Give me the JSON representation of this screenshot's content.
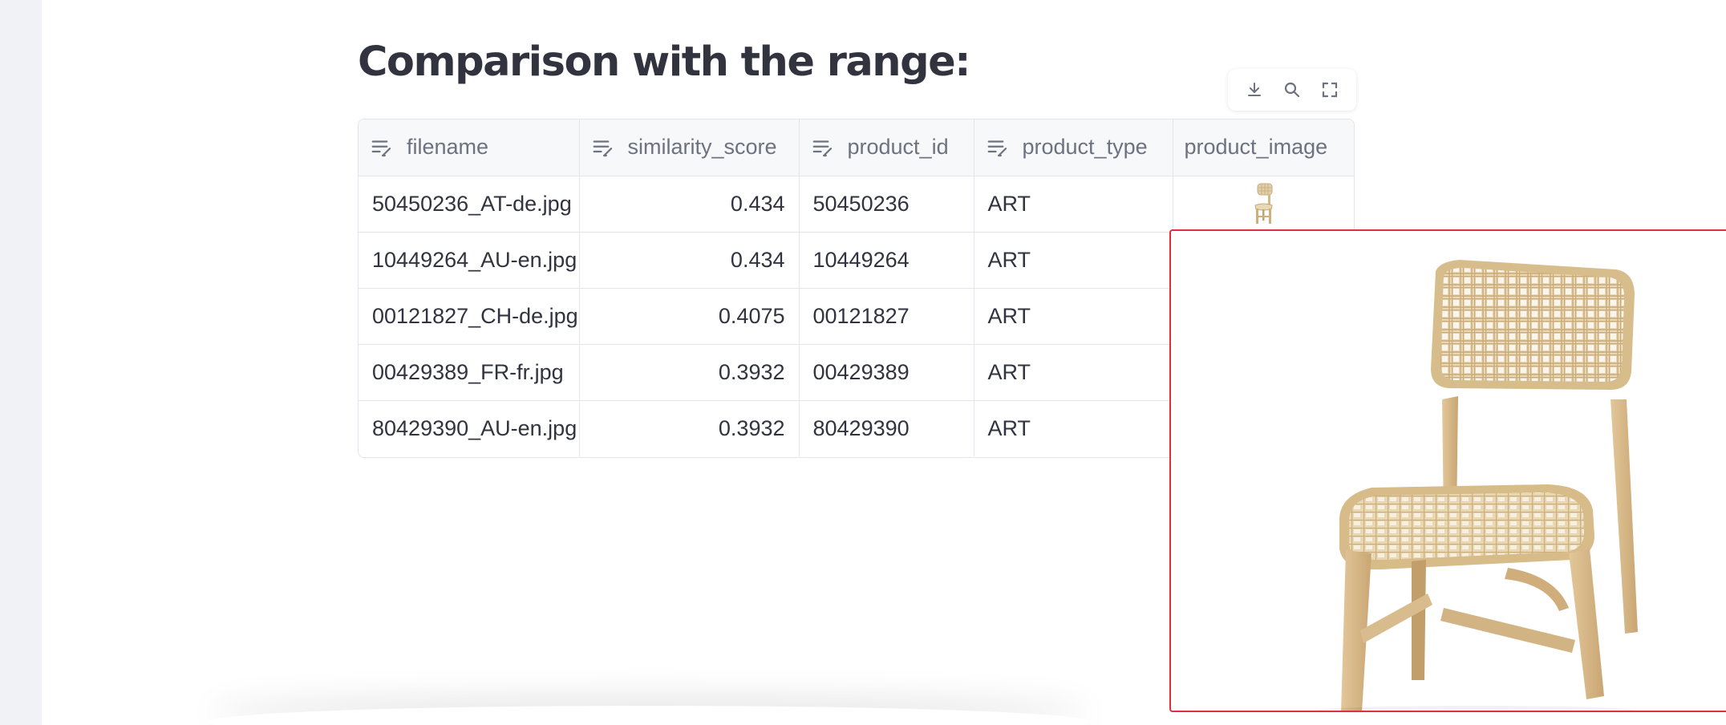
{
  "page": {
    "title": "Comparison with the range:"
  },
  "toolbar": {
    "download_icon": "download-icon",
    "search_icon": "search-icon",
    "fullscreen_icon": "fullscreen-icon"
  },
  "table": {
    "columns": [
      "filename",
      "similarity_score",
      "product_id",
      "product_type",
      "product_image"
    ],
    "column_icons": [
      "edit-text-icon",
      "edit-text-icon",
      "edit-text-icon",
      "edit-text-icon",
      ""
    ],
    "rows": [
      {
        "filename": "50450236_AT-de.jpg",
        "similarity_score": "0.434",
        "product_id": "50450236",
        "product_type": "ART"
      },
      {
        "filename": "10449264_AU-en.jpg",
        "similarity_score": "0.434",
        "product_id": "10449264",
        "product_type": "ART"
      },
      {
        "filename": "00121827_CH-de.jpg",
        "similarity_score": "0.4075",
        "product_id": "00121827",
        "product_type": "ART"
      },
      {
        "filename": "00429389_FR-fr.jpg",
        "similarity_score": "0.3932",
        "product_id": "00429389",
        "product_type": "ART"
      },
      {
        "filename": "80429390_AU-en.jpg",
        "similarity_score": "0.3932",
        "product_id": "80429390",
        "product_type": "ART"
      }
    ]
  },
  "preview": {
    "icon": "chair-image",
    "border_color": "#e0303c"
  },
  "colors": {
    "text": "#31333f",
    "header_text": "#6e7180",
    "grid_border": "#e3e5ea",
    "sidebar_bg": "#f0f2f6"
  }
}
